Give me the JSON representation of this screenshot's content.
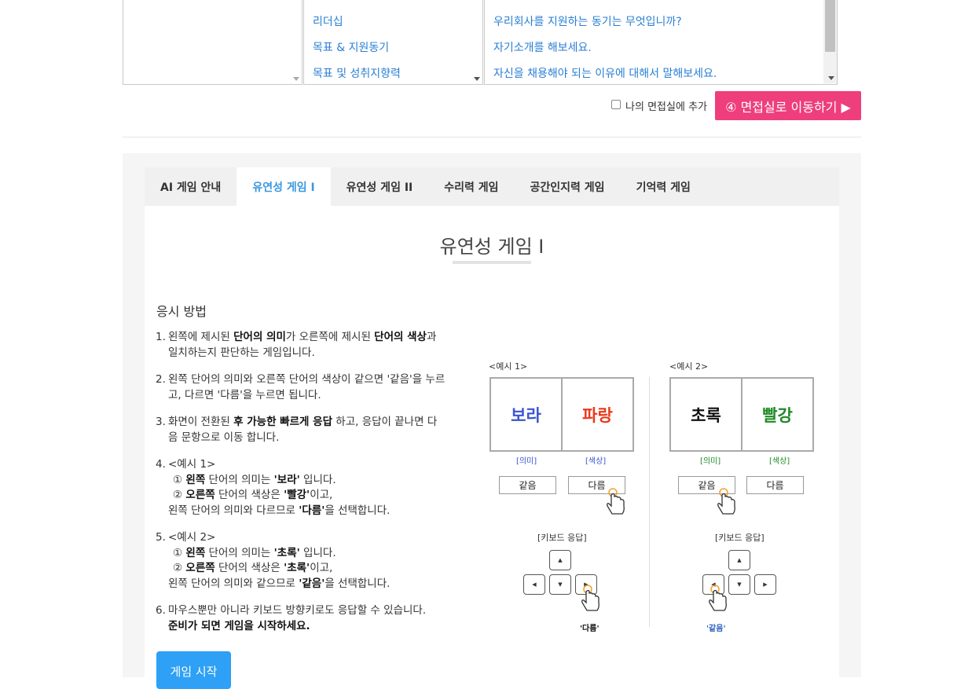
{
  "lists": {
    "categories": [],
    "topics": [
      "리더십",
      "목표 & 지원동기",
      "목표 및 성취지향력"
    ],
    "questions": [
      "우리회사를 지원하는 동기는 무엇입니까?",
      "자기소개를 해보세요.",
      "자신을 채용해야 되는 이유에 대해서 말해보세요."
    ]
  },
  "add_to_room_label": "나의 면접실에 추가",
  "move_button_label": "④ 면접실로 이동하기 ▶",
  "tabs": [
    "AI 게임 안내",
    "유연성 게임 I",
    "유연성 게임 II",
    "수리력 게임",
    "공간인지력 게임",
    "기억력 게임"
  ],
  "active_tab": "유연성 게임 I",
  "title": "유연성 게임 I",
  "howto_heading": "응시 방법",
  "rules": {
    "r1": {
      "num": "1.",
      "a": "왼쪽에 제시된 ",
      "b1": "단어의 의미",
      "c": "가 오른쪽에 제시된 ",
      "b2": "단어의 색상",
      "d": "과 일치하는지 판단하는 게임입니다."
    },
    "r2": {
      "num": "2.",
      "text": "왼쪽 단어의 의미와 오른쪽 단어의 색상이 같으면 '같음'을 누르고, 다르면 '다름'을 누르면 됩니다."
    },
    "r3": {
      "num": "3.",
      "a": "화면이 전환된 ",
      "b": "후 가능한 빠르게 응답",
      "c": " 하고, 응답이 끝나면 다음 문항으로 이동 합니다."
    },
    "r4": {
      "num": "4.",
      "head": "<예시 1>",
      "l1a": "① ",
      "l1b": "왼쪽",
      "l1c": " 단어의 의미는 ",
      "l1d": "'보라'",
      "l1e": " 입니다.",
      "l2a": "② ",
      "l2b": "오른쪽",
      "l2c": " 단어의 색상은 ",
      "l2d": "'빨강'",
      "l2e": "이고,",
      "l3a": "왼쪽 단어의 의미와 다르므로 ",
      "l3b": "'다름'",
      "l3c": "을 선택합니다."
    },
    "r5": {
      "num": "5.",
      "head": "<예시 2>",
      "l1a": "① ",
      "l1b": "왼쪽",
      "l1c": " 단어의 의미는 ",
      "l1d": "'초록'",
      "l1e": " 입니다.",
      "l2a": "② ",
      "l2b": "오른쪽",
      "l2c": " 단어의 색상은 ",
      "l2d": "'초록'",
      "l2e": "이고,",
      "l3a": "왼쪽 단어의 의미와 같으므로 ",
      "l3b": "'같음'",
      "l3c": "을 선택합니다."
    },
    "r6": {
      "num": "6.",
      "a": "마우스뿐만 아니라 키보드 방향키로도 응답할 수 있습니다.",
      "b": "준비가 되면 게임을 시작하세요."
    }
  },
  "start_button_label": "게임 시작",
  "examples": [
    {
      "label": "<예시 1>",
      "left_word": "보라",
      "left_color": "#3a55d0",
      "right_word": "파랑",
      "right_color": "#ea3a1c",
      "tag_left": "[의미]",
      "tag_right": "[색상]",
      "tag_color": "#3a55d0",
      "same": "같음",
      "diff": "다름",
      "kb_label": "[키보드 응답]",
      "key_caption": "'다름'",
      "caption_color": "#111"
    },
    {
      "label": "<예시 2>",
      "left_word": "초록",
      "left_color": "#111111",
      "right_word": "빨강",
      "right_color": "#1f8a26",
      "tag_left": "[의미]",
      "tag_right": "[색상]",
      "tag_color": "#1f8a26",
      "same": "같음",
      "diff": "다름",
      "kb_label": "[키보드 응답]",
      "key_caption": "'같음'",
      "caption_color": "#2a5fc0"
    }
  ],
  "keys": {
    "up": "▲",
    "left": "◀",
    "down": "▼",
    "right": "▶"
  }
}
